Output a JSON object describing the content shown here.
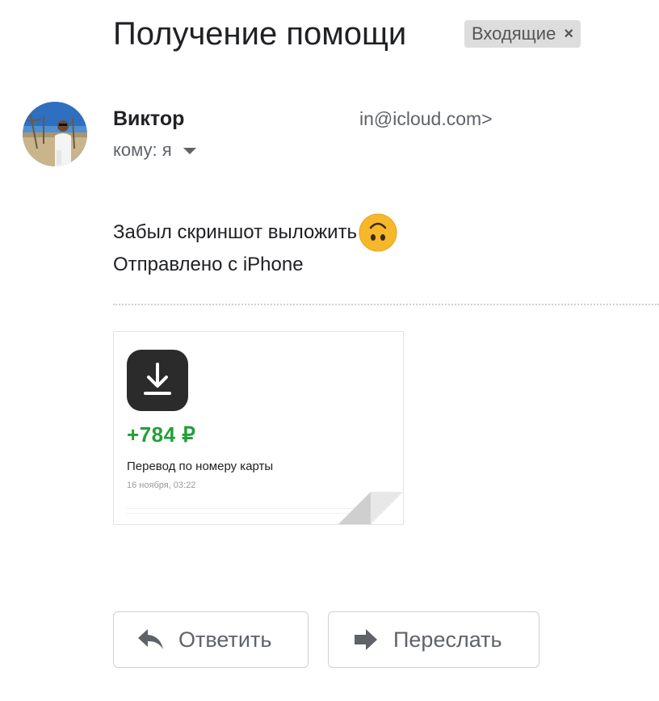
{
  "message": {
    "subject": "Получение помощи",
    "label": {
      "text": "Входящие",
      "remove_glyph": "×"
    },
    "sender": {
      "name": "Виктор",
      "email": "in@icloud.com>"
    },
    "recipient": {
      "text": "кому: я"
    },
    "body": {
      "line1": "Забыл скриншот выложить",
      "emoji": "upside-down-face-emoji",
      "line2": "Отправлено с iPhone"
    }
  },
  "attachment": {
    "icon": "download-icon",
    "amount": "+784 ₽",
    "amount_color": "#21a038",
    "title": "Перевод по номеру карты",
    "date": "16 ноября, 03:22"
  },
  "actions": {
    "reply": {
      "label": "Ответить",
      "icon": "reply-arrow-icon"
    },
    "forward": {
      "label": "Переслать",
      "icon": "forward-arrow-icon"
    }
  }
}
